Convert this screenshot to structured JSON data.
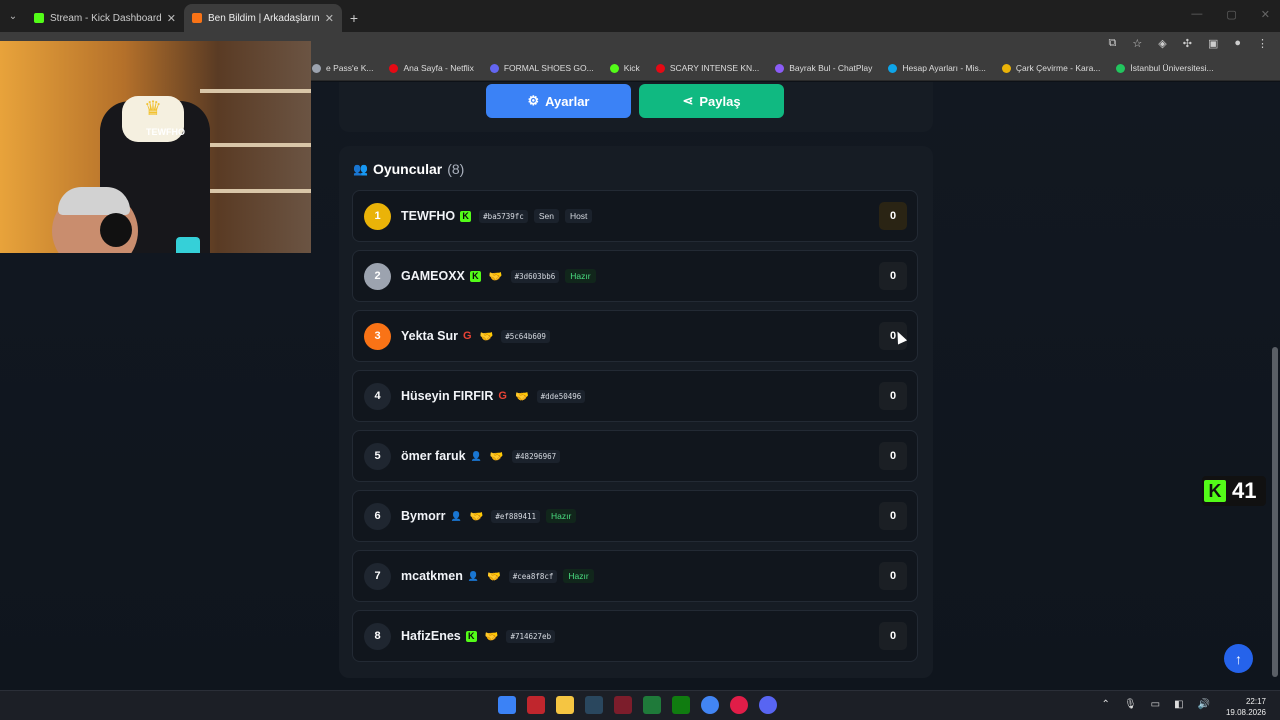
{
  "browser": {
    "tabs": [
      {
        "title": "Stream - Kick Dashboard",
        "color": "#53fc18"
      },
      {
        "title": "Ben Bildim | Arkadaşlarınla Onli",
        "color": "#f97316"
      }
    ],
    "new_tab": "+",
    "bookmarks": [
      {
        "label": "e Pass'e K...",
        "color": "#9ca3af"
      },
      {
        "label": "Ana Sayfa - Netflix",
        "color": "#e50914"
      },
      {
        "label": "FORMAL SHOES GO...",
        "color": "#6366f1"
      },
      {
        "label": "Kick",
        "color": "#53fc18"
      },
      {
        "label": "SCARY INTENSE KN...",
        "color": "#e50914"
      },
      {
        "label": "Bayrak Bul - ChatPlay",
        "color": "#8b5cf6"
      },
      {
        "label": "Hesap Ayarları - Mis...",
        "color": "#0ea5e9"
      },
      {
        "label": "Çark Çevirme - Kara...",
        "color": "#eab308"
      },
      {
        "label": "İstanbul Üniversitesi...",
        "color": "#22c55e"
      }
    ]
  },
  "actions": {
    "settings_label": "Ayarlar",
    "share_label": "Paylaş"
  },
  "players": {
    "title": "Oyuncular",
    "count": "(8)",
    "rows": [
      {
        "rank": "1",
        "name": "TEWFHO",
        "provider": "kick",
        "code": "#ba5739fc",
        "tags": [
          "Sen",
          "Host"
        ],
        "score": "0"
      },
      {
        "rank": "2",
        "name": "GAMEOXX",
        "provider": "kick",
        "code": "#3d603bb6",
        "tags": [
          "Hazır"
        ],
        "score": "0"
      },
      {
        "rank": "3",
        "name": "Yekta Sur",
        "provider": "google",
        "code": "#5c64b609",
        "tags": [],
        "score": "0"
      },
      {
        "rank": "4",
        "name": "Hüseyin FIRFIR",
        "provider": "google",
        "code": "#dde50496",
        "tags": [],
        "score": "0"
      },
      {
        "rank": "5",
        "name": "ömer faruk",
        "provider": "guest",
        "code": "#48296967",
        "tags": [],
        "score": "0"
      },
      {
        "rank": "6",
        "name": "Bymorr",
        "provider": "guest",
        "code": "#ef889411",
        "tags": [
          "Hazır"
        ],
        "score": "0"
      },
      {
        "rank": "7",
        "name": "mcatkmen",
        "provider": "guest",
        "code": "#cea8f8cf",
        "tags": [
          "Hazır"
        ],
        "score": "0"
      },
      {
        "rank": "8",
        "name": "HafizEnes",
        "provider": "kick",
        "code": "#714627eb",
        "tags": [],
        "score": "0"
      }
    ]
  },
  "overlay": {
    "webcam_chair_text": "TEWFHO",
    "viewer_count": "41"
  },
  "taskbar": {
    "time": "22:17",
    "date": "19.08.2026"
  }
}
